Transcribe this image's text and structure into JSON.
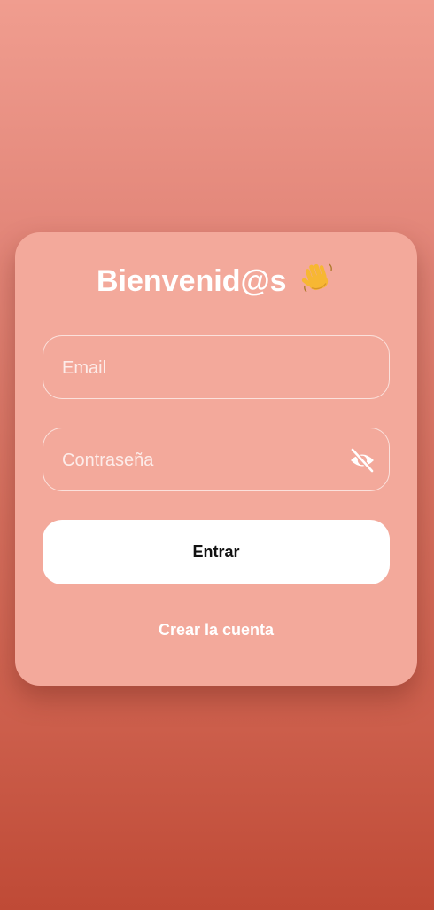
{
  "login": {
    "title": "Bienvenid@s",
    "title_emoji": "waving-hand",
    "email_placeholder": "Email",
    "email_value": "",
    "password_placeholder": "Contraseña",
    "password_value": "",
    "visibility_icon": "eye-off-icon",
    "submit_label": "Entrar",
    "create_account_label": "Crear la cuenta"
  },
  "colors": {
    "background_top": "#f09d8f",
    "background_bottom": "#bf4a36",
    "card": "#f3a99b",
    "button": "#ffffff",
    "text": "#ffffff"
  }
}
